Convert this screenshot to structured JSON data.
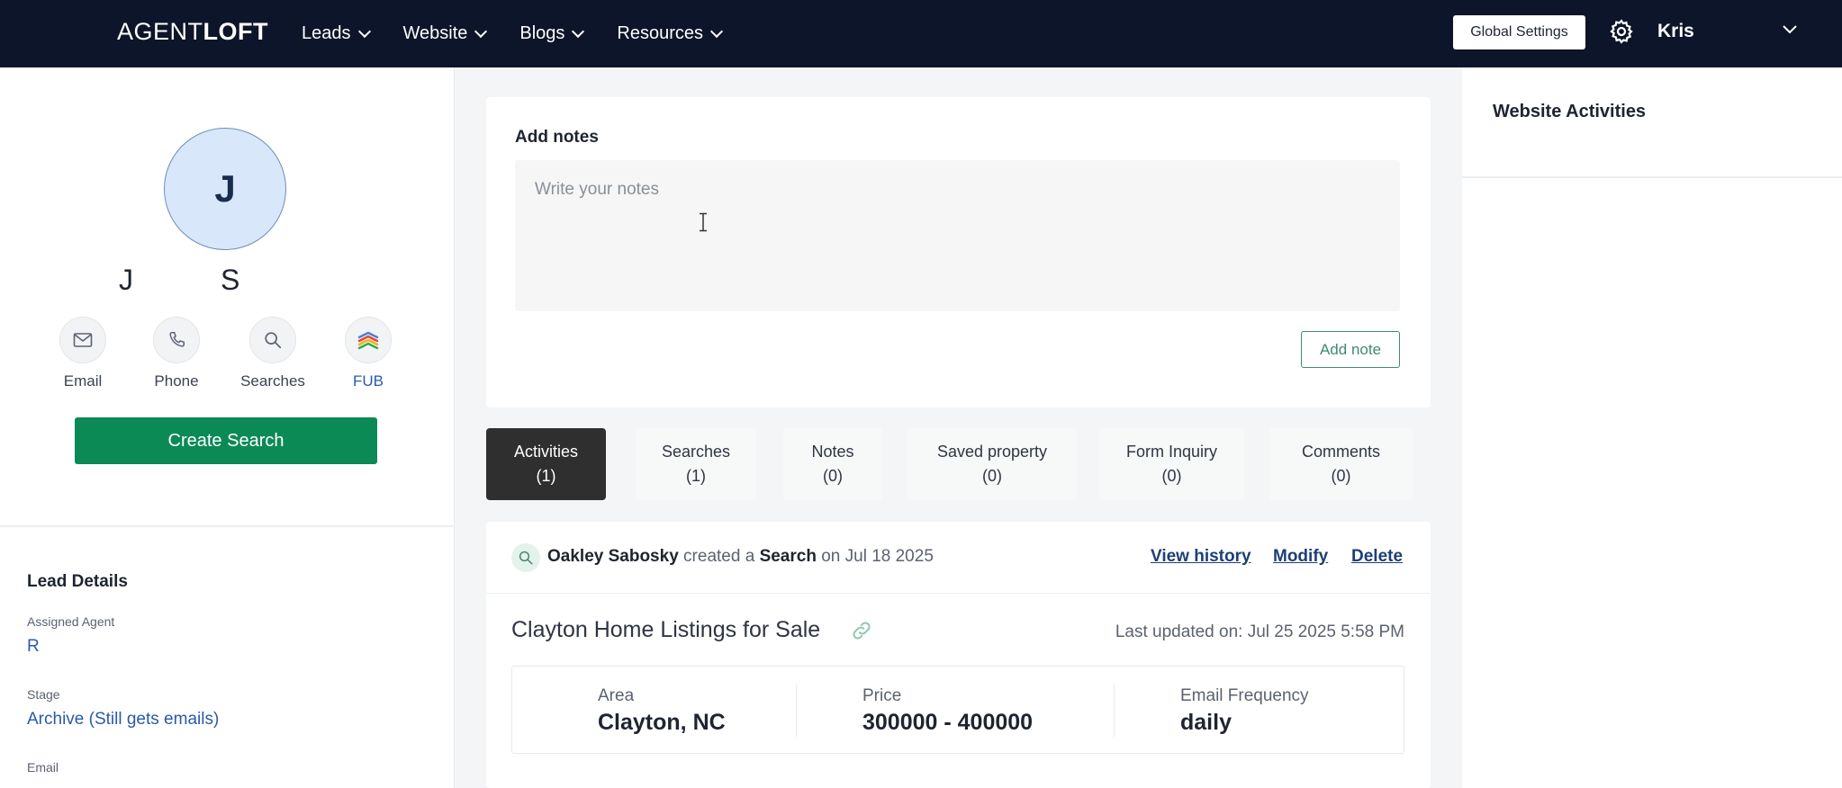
{
  "header": {
    "brand_light": "AGENT",
    "brand_bold": "LOFT",
    "nav": [
      {
        "label": "Leads"
      },
      {
        "label": "Website"
      },
      {
        "label": "Blogs"
      },
      {
        "label": "Resources"
      }
    ],
    "global_settings_label": "Global Settings",
    "user_name": "Kris"
  },
  "profile": {
    "avatar_initial": "J",
    "first_name": "J",
    "last_name": "S",
    "actions": [
      {
        "label": "Email",
        "icon": "envelope-icon"
      },
      {
        "label": "Phone",
        "icon": "phone-icon"
      },
      {
        "label": "Searches",
        "icon": "search-icon"
      },
      {
        "label": "FUB",
        "icon": "fub-logo-icon"
      }
    ],
    "create_search_label": "Create Search"
  },
  "lead_details": {
    "title": "Lead Details",
    "assigned_agent_label": "Assigned Agent",
    "assigned_agent_value": "R",
    "stage_label": "Stage",
    "stage_value": "Archive (Still gets emails)",
    "email_label": "Email"
  },
  "notes": {
    "title": "Add notes",
    "placeholder": "Write your notes",
    "add_button": "Add note"
  },
  "tabs": [
    {
      "label": "Activities",
      "count": "(1)",
      "active": true
    },
    {
      "label": "Searches",
      "count": "(1)",
      "active": false
    },
    {
      "label": "Notes",
      "count": "(0)",
      "active": false
    },
    {
      "label": "Saved property",
      "count": "(0)",
      "active": false
    },
    {
      "label": "Form Inquiry",
      "count": "(0)",
      "active": false
    },
    {
      "label": "Comments",
      "count": "(0)",
      "active": false
    }
  ],
  "activity": {
    "actor": "Oakley Sabosky",
    "verb": "created a",
    "object": "Search",
    "on": "on",
    "date": "Jul 18 2025",
    "links": {
      "history": "View history",
      "modify": "Modify",
      "delete": "Delete"
    },
    "search_title": "Clayton Home Listings for Sale",
    "last_updated": "Last updated on: Jul 25 2025 5:58 PM",
    "details": {
      "area_label": "Area",
      "area_value": "Clayton, NC",
      "price_label": "Price",
      "price_value": "300000 - 400000",
      "freq_label": "Email Frequency",
      "freq_value": "daily"
    }
  },
  "right_panel": {
    "title": "Website Activities"
  },
  "colors": {
    "topbar": "#0c1529",
    "primary_green": "#0b8a55",
    "link_blue": "#1d3f76",
    "avatar_bg": "#d8e7fa"
  }
}
